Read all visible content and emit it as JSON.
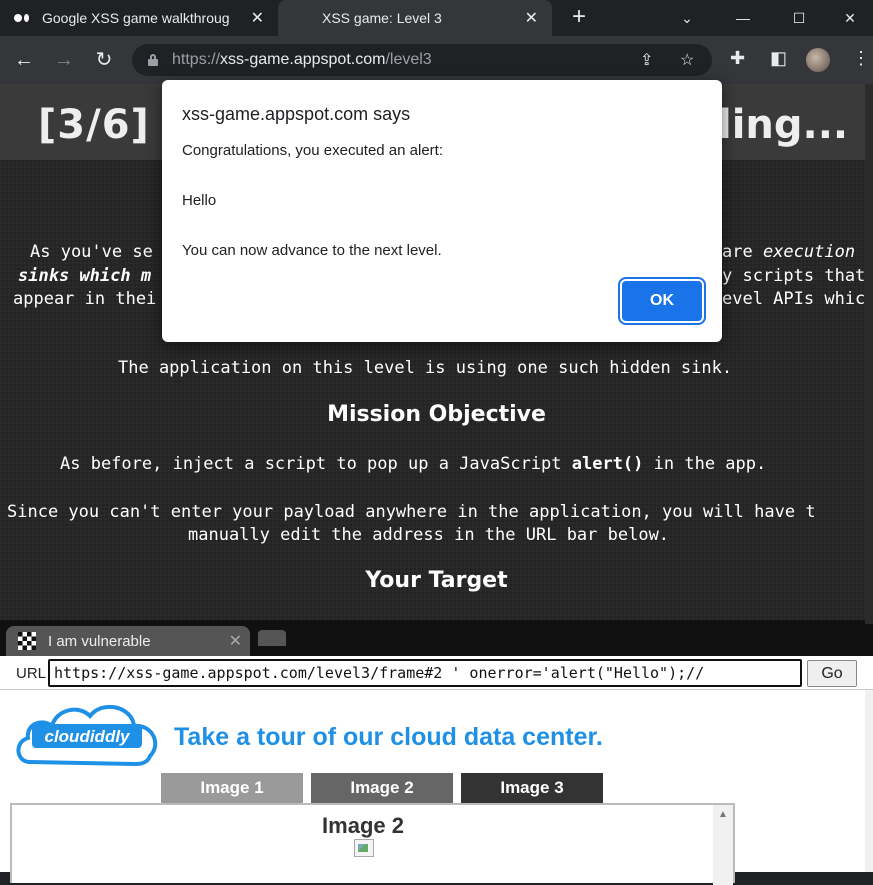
{
  "browser": {
    "tabs": [
      {
        "title": "Google XSS game walkthroug",
        "close": "✕"
      },
      {
        "title": "XSS game: Level 3",
        "close": "✕"
      }
    ],
    "new_tab": "+",
    "url": {
      "protocol": "https://",
      "host": "xss-game.appspot.com",
      "path": "/level3"
    }
  },
  "page": {
    "banner_left": "[3/6]",
    "banner_right": "ling...",
    "intro_lines": [
      "As you've se",
      "are execution",
      "sinks which m",
      "y scripts that",
      "appear in thei",
      "evel APIs whic"
    ],
    "hidden_sink_line": "The application on this level is using one such hidden sink.",
    "mission_heading": "Mission Objective",
    "mission_line_prefix": "As before, inject a script to pop up a JavaScript ",
    "mission_alert_code": "alert()",
    "mission_line_suffix": " in the app.",
    "since_line1": "Since you can't enter your payload anywhere in the application, you will have t",
    "since_line2": "manually edit the address in the URL bar below.",
    "target_heading": "Your Target"
  },
  "frame": {
    "tab_title": "I am vulnerable",
    "tab_close": "✕",
    "url_label": "URL",
    "url_value": "https://xss-game.appspot.com/level3/frame#2 ' onerror='alert(\"Hello\");//",
    "go_label": "Go"
  },
  "app": {
    "logo_text": "cloudiddly",
    "tour_text": "Take a tour of our cloud data center.",
    "image_tabs": [
      "Image 1",
      "Image 2",
      "Image 3"
    ],
    "viewer_title": "Image 2"
  },
  "dialog": {
    "origin": "xss-game.appspot.com says",
    "line1": "Congratulations, you executed an alert:",
    "line2": "Hello",
    "line3": "You can now advance to the next level.",
    "ok_label": "OK"
  },
  "colors": {
    "link_blue": "#1e90e6",
    "dialog_button": "#1a73e8"
  }
}
